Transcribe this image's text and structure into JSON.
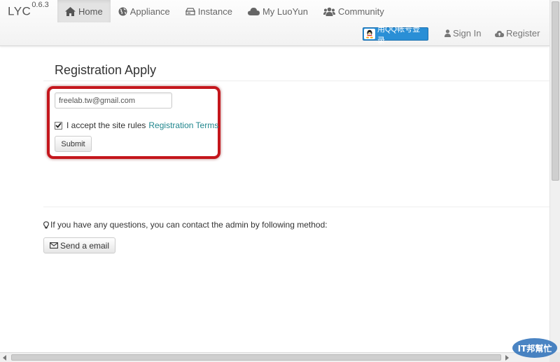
{
  "brand": {
    "name": "LYC",
    "version": "0.6.3"
  },
  "nav": {
    "items": [
      {
        "label": "Home",
        "icon": "home-icon",
        "active": true
      },
      {
        "label": "Appliance",
        "icon": "globe-icon"
      },
      {
        "label": "Instance",
        "icon": "server-icon"
      },
      {
        "label": "My LuoYun",
        "icon": "cloud-icon"
      },
      {
        "label": "Community",
        "icon": "group-icon"
      }
    ]
  },
  "auth": {
    "qq_login_label": "用QQ帐号登录",
    "sign_in": "Sign In",
    "register": "Register"
  },
  "page": {
    "title": "Registration Apply"
  },
  "form": {
    "email_value": "freelab.tw@gmail.com",
    "accept_checked": true,
    "accept_text": "I accept the site rules",
    "terms_link": "Registration Terms",
    "submit_label": "Submit"
  },
  "contact": {
    "text": "If you have any questions, you can contact the admin by following method:",
    "email_button": "Send a email"
  },
  "watermark": {
    "text": "IT邦幫忙"
  },
  "colors": {
    "highlight": "#c4161c",
    "link": "#20868d",
    "qq_button": "#2a8fd6",
    "watermark": "#2a6fb8"
  }
}
